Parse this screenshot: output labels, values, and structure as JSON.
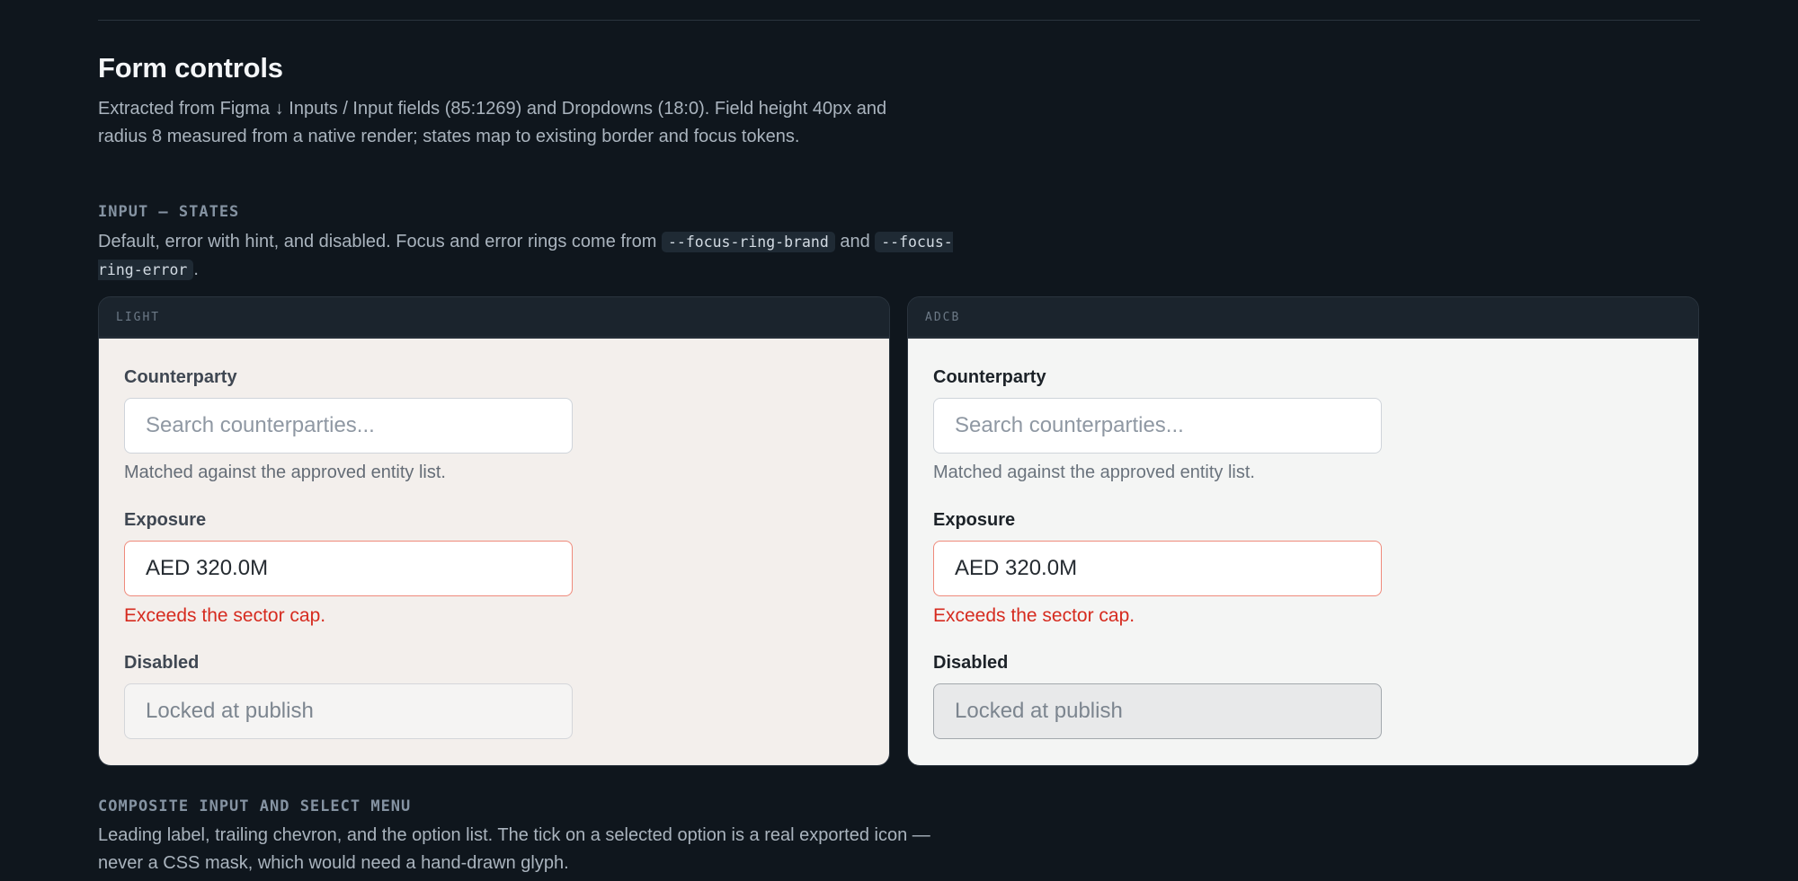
{
  "section": {
    "title": "Form controls",
    "description": "Extracted from Figma ↓ Inputs / Input fields (85:1269) and Dropdowns (18:0). Field height 40px and radius 8 measured from a native render; states map to existing border and focus tokens."
  },
  "input_states": {
    "heading": "INPUT — STATES",
    "desc_prefix": "Default, error with hint, and disabled. Focus and error rings come from ",
    "token_brand": "--focus-ring-brand",
    "desc_and": " and ",
    "token_error": "--focus-ring-error",
    "desc_suffix": "."
  },
  "panels": [
    {
      "name": "LIGHT",
      "counterparty_label": "Counterparty",
      "counterparty_placeholder": "Search counterparties...",
      "counterparty_hint": "Matched against the approved entity list.",
      "exposure_label": "Exposure",
      "exposure_value": "AED 320.0M",
      "exposure_error": "Exceeds the sector cap.",
      "disabled_label": "Disabled",
      "disabled_placeholder": "Locked at publish"
    },
    {
      "name": "ADCB",
      "counterparty_label": "Counterparty",
      "counterparty_placeholder": "Search counterparties...",
      "counterparty_hint": "Matched against the approved entity list.",
      "exposure_label": "Exposure",
      "exposure_value": "AED 320.0M",
      "exposure_error": "Exceeds the sector cap.",
      "disabled_label": "Disabled",
      "disabled_placeholder": "Locked at publish"
    }
  ],
  "composite": {
    "heading": "COMPOSITE INPUT AND SELECT MENU",
    "description": "Leading label, trailing chevron, and the option list. The tick on a selected option is a real exported icon — never a CSS mask, which would need a hand-drawn glyph."
  },
  "colors": {
    "page_bg": "#0f161d",
    "error_border": "#ef8a7b",
    "error_text": "#d62b1f",
    "light_surface": "#f3efec",
    "adcb_surface": "#f4f5f4"
  }
}
